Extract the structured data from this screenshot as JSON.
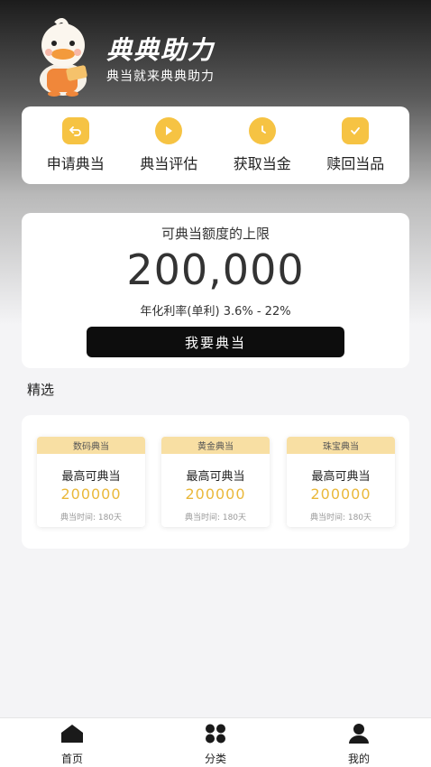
{
  "header": {
    "title": "典典助力",
    "subtitle": "典当就来典典助力"
  },
  "services": [
    {
      "label": "申请典当",
      "icon": "return-arrow-icon"
    },
    {
      "label": "典当评估",
      "icon": "play-icon"
    },
    {
      "label": "获取当金",
      "icon": "clock-icon"
    },
    {
      "label": "赎回当品",
      "icon": "clipboard-check-icon"
    }
  ],
  "limit": {
    "caption": "可典当额度的上限",
    "amount": "200,000",
    "rate": "年化利率(单利) 3.6% - 22%",
    "button_label": "我要典当"
  },
  "featured": {
    "title": "精选",
    "cards": [
      {
        "category": "数码典当",
        "label": "最高可典当",
        "value": "200000",
        "term": "典当时间:   180天"
      },
      {
        "category": "黄金典当",
        "label": "最高可典当",
        "value": "200000",
        "term": "典当时间:   180天"
      },
      {
        "category": "珠宝典当",
        "label": "最高可典当",
        "value": "200000",
        "term": "典当时间:   180天"
      }
    ]
  },
  "tabbar": [
    {
      "label": "首页",
      "icon": "home-icon"
    },
    {
      "label": "分类",
      "icon": "grid-icon"
    },
    {
      "label": "我的",
      "icon": "user-icon"
    }
  ],
  "colors": {
    "accent": "#f6c343",
    "value_gold": "#eab83a",
    "card_head": "#f8dfa3",
    "button": "#0d0d0d"
  }
}
